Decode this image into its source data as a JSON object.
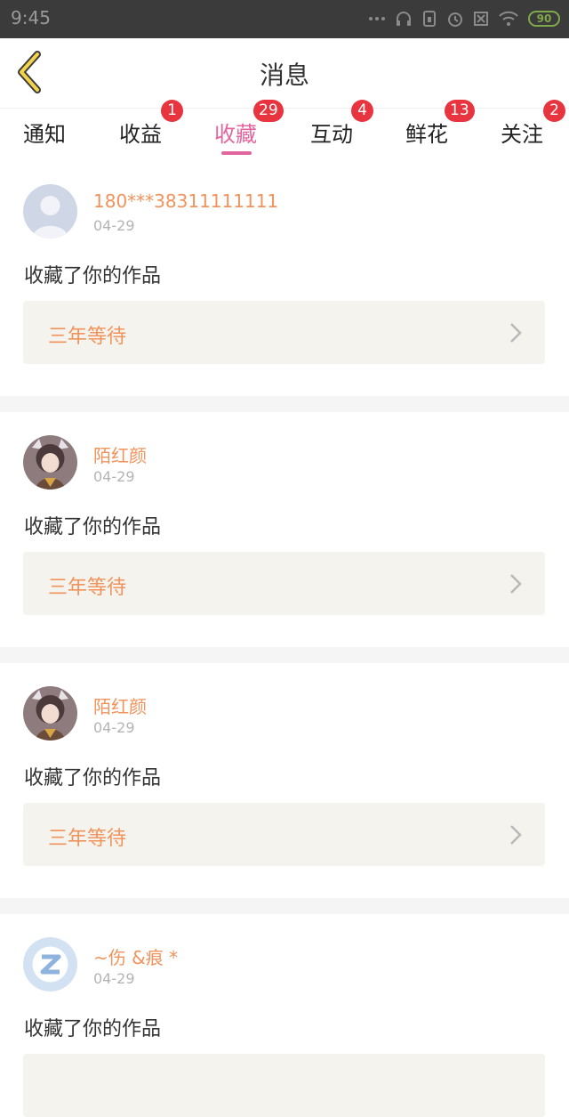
{
  "status_bar": {
    "time": "9:45",
    "battery": "90"
  },
  "header": {
    "title": "消息",
    "back_icon": "chevron-left-icon"
  },
  "tabs": [
    {
      "label": "通知",
      "badge": ""
    },
    {
      "label": "收益",
      "badge": "1"
    },
    {
      "label": "收藏",
      "badge": "29",
      "active": true
    },
    {
      "label": "互动",
      "badge": "4"
    },
    {
      "label": "鲜花",
      "badge": "13"
    },
    {
      "label": "关注",
      "badge": "2"
    }
  ],
  "colors": {
    "accent_pink": "#e2669d",
    "username_orange": "#f0935c",
    "badge_red": "#e8343f",
    "work_box_bg": "#f4f3ee"
  },
  "feed": [
    {
      "username": "180***38311111111",
      "date": "04-29",
      "action": "收藏了你的作品",
      "work": "三年等待",
      "avatar": "default-user-avatar"
    },
    {
      "username": "陌红颜",
      "date": "04-29",
      "action": "收藏了你的作品",
      "work": "三年等待",
      "avatar": "anime-girl-avatar"
    },
    {
      "username": "陌红颜",
      "date": "04-29",
      "action": "收藏了你的作品",
      "work": "三年等待",
      "avatar": "anime-girl-avatar"
    },
    {
      "username": "~伤 &痕 *",
      "date": "04-29",
      "action": "收藏了你的作品",
      "work": "",
      "avatar": "qq-z-avatar"
    }
  ]
}
